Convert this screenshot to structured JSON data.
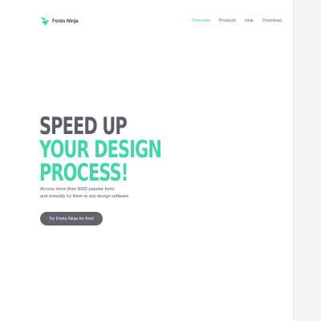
{
  "brand": {
    "name": "Fonts Ninja",
    "accent_color": "#3fd6a8",
    "dark_color": "#5d5c68"
  },
  "nav": {
    "items": [
      {
        "label": "Overview",
        "active": true
      },
      {
        "label": "Products",
        "active": false
      },
      {
        "label": "Help",
        "active": false
      },
      {
        "label": "Download",
        "active": false
      }
    ]
  },
  "hero": {
    "title_lines": [
      "SPEED UP",
      "YOUR DESIGN",
      "PROCESS!"
    ],
    "description_lines": [
      "Access more than 3000 popular fonts",
      "and instantly try them in any design software."
    ],
    "cta_label": "Try Fonts Ninja for free!"
  }
}
